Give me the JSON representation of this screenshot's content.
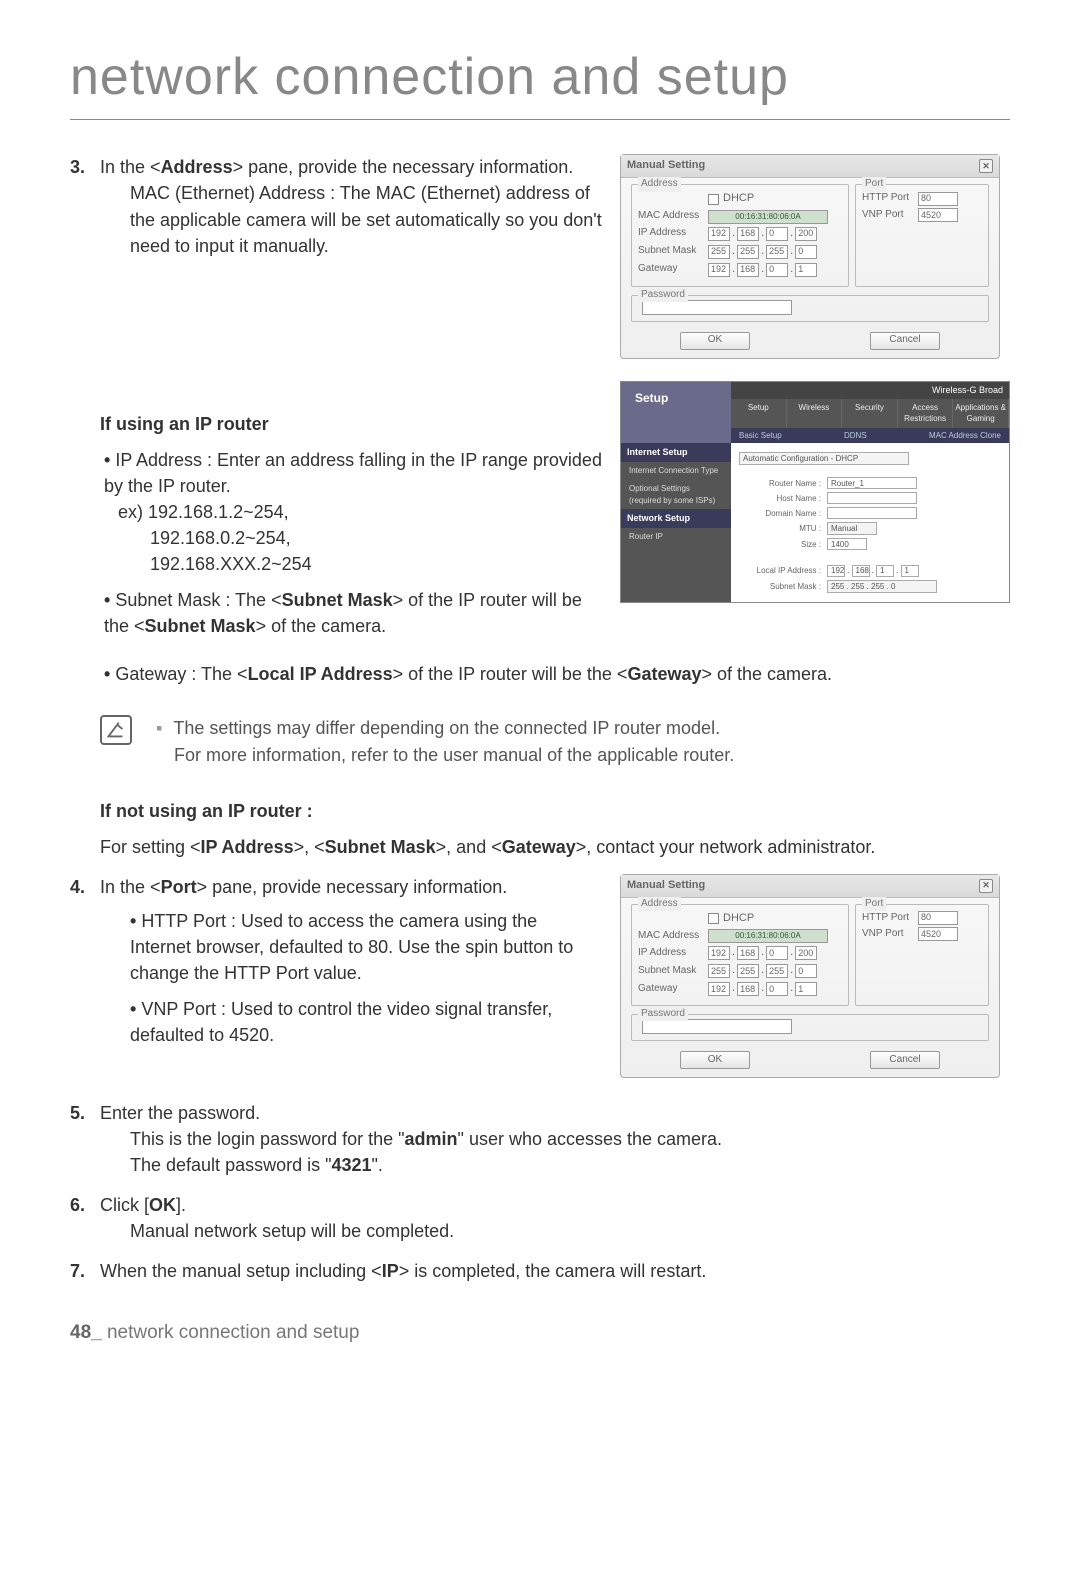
{
  "page": {
    "title": "network connection and setup",
    "footer_page": "48_",
    "footer_text": "network connection and setup"
  },
  "step3": {
    "num": "3.",
    "text_a": "In the <",
    "text_b": "Address",
    "text_c": "> pane, provide the necessary information.",
    "mac_line": "MAC (Ethernet) Address : The MAC (Ethernet) address of the applicable camera will be set automatically so you don't need to input it manually."
  },
  "iprouter": {
    "heading": "If using an IP router",
    "b1_a": "IP Address : Enter an address falling in the IP range provided by the IP router.",
    "b1_ex": "ex) 192.168.1.2~254,",
    "b1_ex2": "192.168.0.2~254,",
    "b1_ex3": "192.168.XXX.2~254",
    "b2_a": "Subnet Mask : The <",
    "b2_b": "Subnet Mask",
    "b2_c": "> of the IP router will be the <",
    "b2_d": "Subnet Mask",
    "b2_e": "> of the camera.",
    "b3_a": "Gateway : The <",
    "b3_b": "Local IP Address",
    "b3_c": "> of the IP router will be the <",
    "b3_d": "Gateway",
    "b3_e": "> of the camera."
  },
  "note": {
    "l1": "The settings may differ depending on the connected IP router model.",
    "l2": "For more information, refer to the user manual of the applicable router."
  },
  "noiprouter": {
    "heading": "If not using an IP router :",
    "p_a": "For setting <",
    "p_b": "IP Address",
    "p_c": ">, <",
    "p_d": "Subnet Mask",
    "p_e": ">, and <",
    "p_f": "Gateway",
    "p_g": ">, contact your network administrator."
  },
  "step4": {
    "num": "4.",
    "text_a": "In the <",
    "text_b": "Port",
    "text_c": "> pane, provide necessary information.",
    "b1": "HTTP Port : Used to access the camera using the Internet browser, defaulted to 80. Use the spin button to change the HTTP Port value.",
    "b2": "VNP Port : Used to control the video signal transfer, defaulted to 4520."
  },
  "step5": {
    "num": "5.",
    "l1": "Enter the password.",
    "l2_a": "This is the login password for the \"",
    "l2_b": "admin",
    "l2_c": "\" user who accesses the camera.",
    "l3_a": "The default password is \"",
    "l3_b": "4321",
    "l3_c": "\"."
  },
  "step6": {
    "num": "6.",
    "l1_a": "Click [",
    "l1_b": "OK",
    "l1_c": "].",
    "l2": "Manual network setup will be completed."
  },
  "step7": {
    "num": "7.",
    "l1_a": "When the manual setup including <",
    "l1_b": "IP",
    "l1_c": "> is completed, the camera will restart."
  },
  "dialog": {
    "title": "Manual Setting",
    "addr_legend": "Address",
    "port_legend": "Port",
    "pwd_legend": "Password",
    "dhcp": "DHCP",
    "mac_label": "MAC Address",
    "mac_value": "00:16:31:80:06:0A",
    "ip_label": "IP Address",
    "ip": [
      "192",
      "168",
      "0",
      "200"
    ],
    "sm_label": "Subnet Mask",
    "sm": [
      "255",
      "255",
      "255",
      "0"
    ],
    "gw_label": "Gateway",
    "gw": [
      "192",
      "168",
      "0",
      "1"
    ],
    "http_label": "HTTP Port",
    "http_val": "80",
    "vnp_label": "VNP Port",
    "vnp_val": "4520",
    "ok": "OK",
    "cancel": "Cancel"
  },
  "router": {
    "brand": "Wireless-G Broad",
    "setup": "Setup",
    "tabs": [
      "Setup",
      "Wireless",
      "Security",
      "Access Restrictions",
      "Applications & Gaming"
    ],
    "sub_l": "Basic Setup",
    "sub_m": "DDNS",
    "sub_r": "MAC Address Clone",
    "side1": "Internet Setup",
    "side1a": "Internet Connection Type",
    "side1b": "Optional Settings (required by some ISPs)",
    "side2": "Network Setup",
    "side2a": "Router IP",
    "conn_type": "Automatic Configuration - DHCP",
    "rn_label": "Router Name :",
    "rn_val": "Router_1",
    "hn_label": "Host Name :",
    "dn_label": "Domain Name :",
    "mtu_label": "MTU :",
    "mtu_val": "Manual",
    "size_label": "Size :",
    "size_val": "1400",
    "lip_label": "Local IP Address :",
    "lip": [
      "192",
      "168",
      "1",
      "1"
    ],
    "lsm_label": "Subnet Mask :",
    "lsm": "255 . 255 . 255 . 0"
  }
}
